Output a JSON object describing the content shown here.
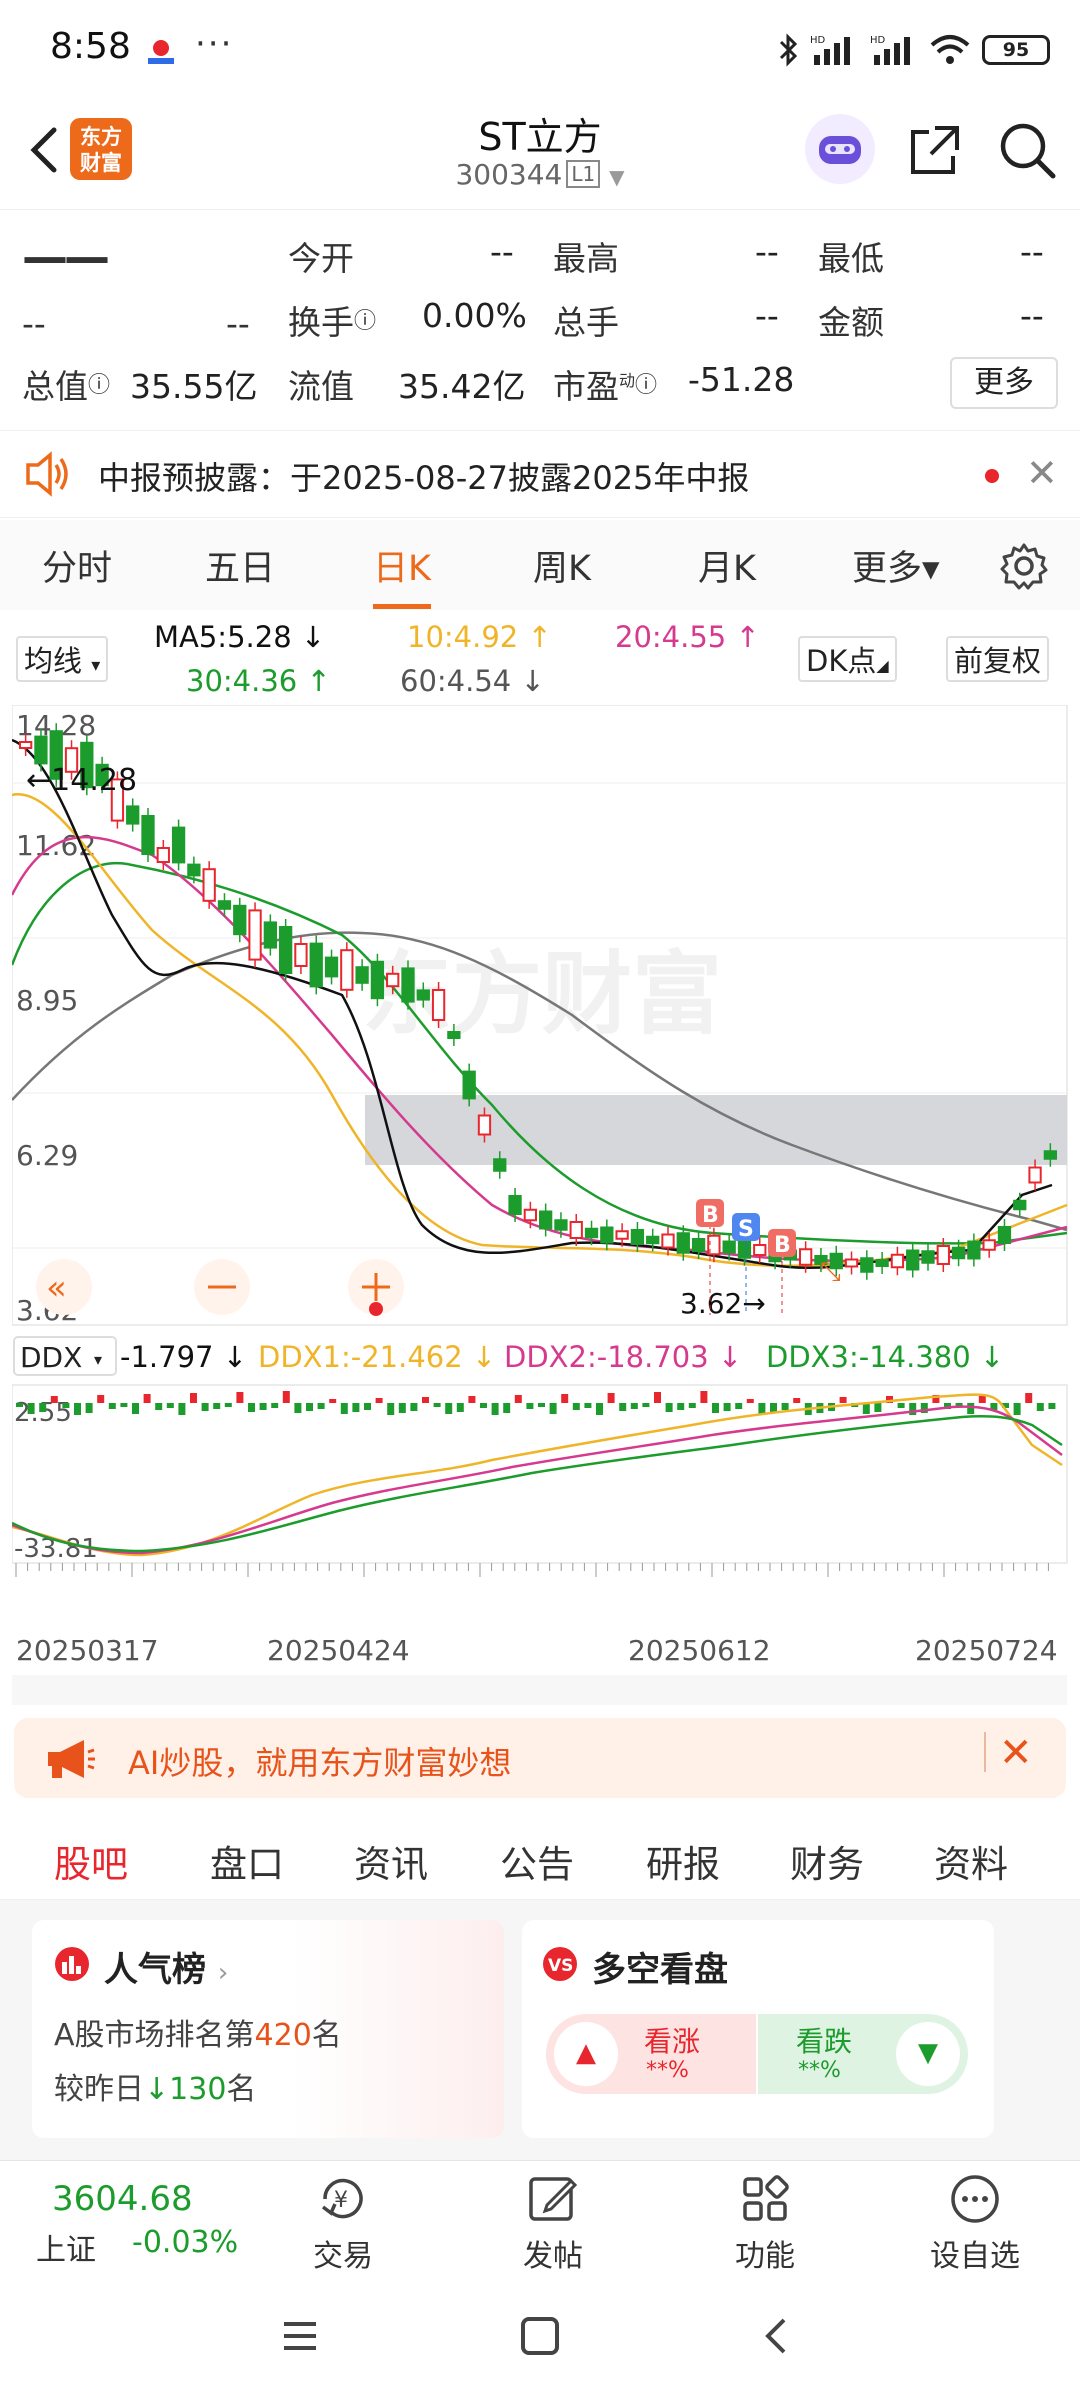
{
  "status_bar": {
    "time": "8:58",
    "battery": "95"
  },
  "header": {
    "back_icon": "chevron-left-icon",
    "logo_text_1": "东方",
    "logo_text_2": "财富",
    "title": "ST立方",
    "code": "300344",
    "board": "L1"
  },
  "quote": {
    "price": "——",
    "change": "--",
    "change_pct": "--",
    "open_label": "今开",
    "open_value": "--",
    "high_label": "最高",
    "high_value": "--",
    "low_label": "最低",
    "low_value": "--",
    "turnover_label": "换手",
    "turnover_value": "0.00%",
    "volume_label": "总手",
    "volume_value": "--",
    "amount_label": "金额",
    "amount_value": "--",
    "mktcap_label": "总值",
    "mktcap_value": "35.55亿",
    "float_label": "流值",
    "float_value": "35.42亿",
    "pe_label": "市盈",
    "pe_sup": "动",
    "pe_value": "-51.28",
    "more_label": "更多"
  },
  "notice": {
    "text": "中报预披露：于2025-08-27披露2025年中报"
  },
  "chart_tabs": [
    {
      "label": "分时"
    },
    {
      "label": "五日"
    },
    {
      "label": "日K"
    },
    {
      "label": "周K"
    },
    {
      "label": "月K"
    },
    {
      "label": "更多▾"
    }
  ],
  "ma": {
    "selector": "均线",
    "ma5": "MA5:5.28 ↓",
    "ma10": "10:4.92 ↑",
    "ma20": "20:4.55 ↑",
    "ma30": "30:4.36 ↑",
    "ma60": "60:4.54 ↓",
    "dk_button": "DK点",
    "adjust_button": "前复权"
  },
  "colors": {
    "ma5": "#111111",
    "ma10": "#f0b428",
    "ma20": "#d63a8e",
    "ma30": "#1c9c2c",
    "ma60": "#666666",
    "up": "#e8262d",
    "down": "#1c9c2c",
    "brand": "#ee6a1b"
  },
  "kchart": {
    "ylabels": [
      "14.28",
      "11.62",
      "8.95",
      "6.29",
      "3.62"
    ],
    "high_marker": "14.28",
    "low_marker": "3.62",
    "watermark": "东方财富",
    "signals": [
      "B",
      "S",
      "B"
    ]
  },
  "ddx": {
    "selector": "DDX",
    "ddx": "-1.797 ↓",
    "ddx1": "DDX1:-21.462 ↓",
    "ddx2": "DDX2:-18.703 ↓",
    "ddx3": "DDX3:-14.380 ↓",
    "ylabel_top": "2.55",
    "ylabel_bottom": "-33.81"
  },
  "dates": [
    "20250317",
    "20250424",
    "20250612",
    "20250724"
  ],
  "ai_banner": {
    "text": "AI炒股，就用东方财富妙想"
  },
  "bottom_tabs": [
    {
      "label": "股吧"
    },
    {
      "label": "盘口"
    },
    {
      "label": "资讯"
    },
    {
      "label": "公告"
    },
    {
      "label": "研报"
    },
    {
      "label": "财务"
    },
    {
      "label": "资料"
    }
  ],
  "popularity": {
    "title": "人气榜",
    "rank_prefix": "A股市场排名第",
    "rank": "420",
    "rank_suffix": "名",
    "change_prefix": "较昨日",
    "change": "130",
    "change_suffix": "名"
  },
  "sentiment": {
    "title": "多空看盘",
    "bull_label": "看涨",
    "bull_value": "**%",
    "bear_label": "看跌",
    "bear_value": "**%"
  },
  "bottom_nav": {
    "index_value": "3604.68",
    "index_name": "上证",
    "index_change": "-0.03%",
    "trade": "交易",
    "post": "发帖",
    "function": "功能",
    "watchlist": "设自选"
  }
}
